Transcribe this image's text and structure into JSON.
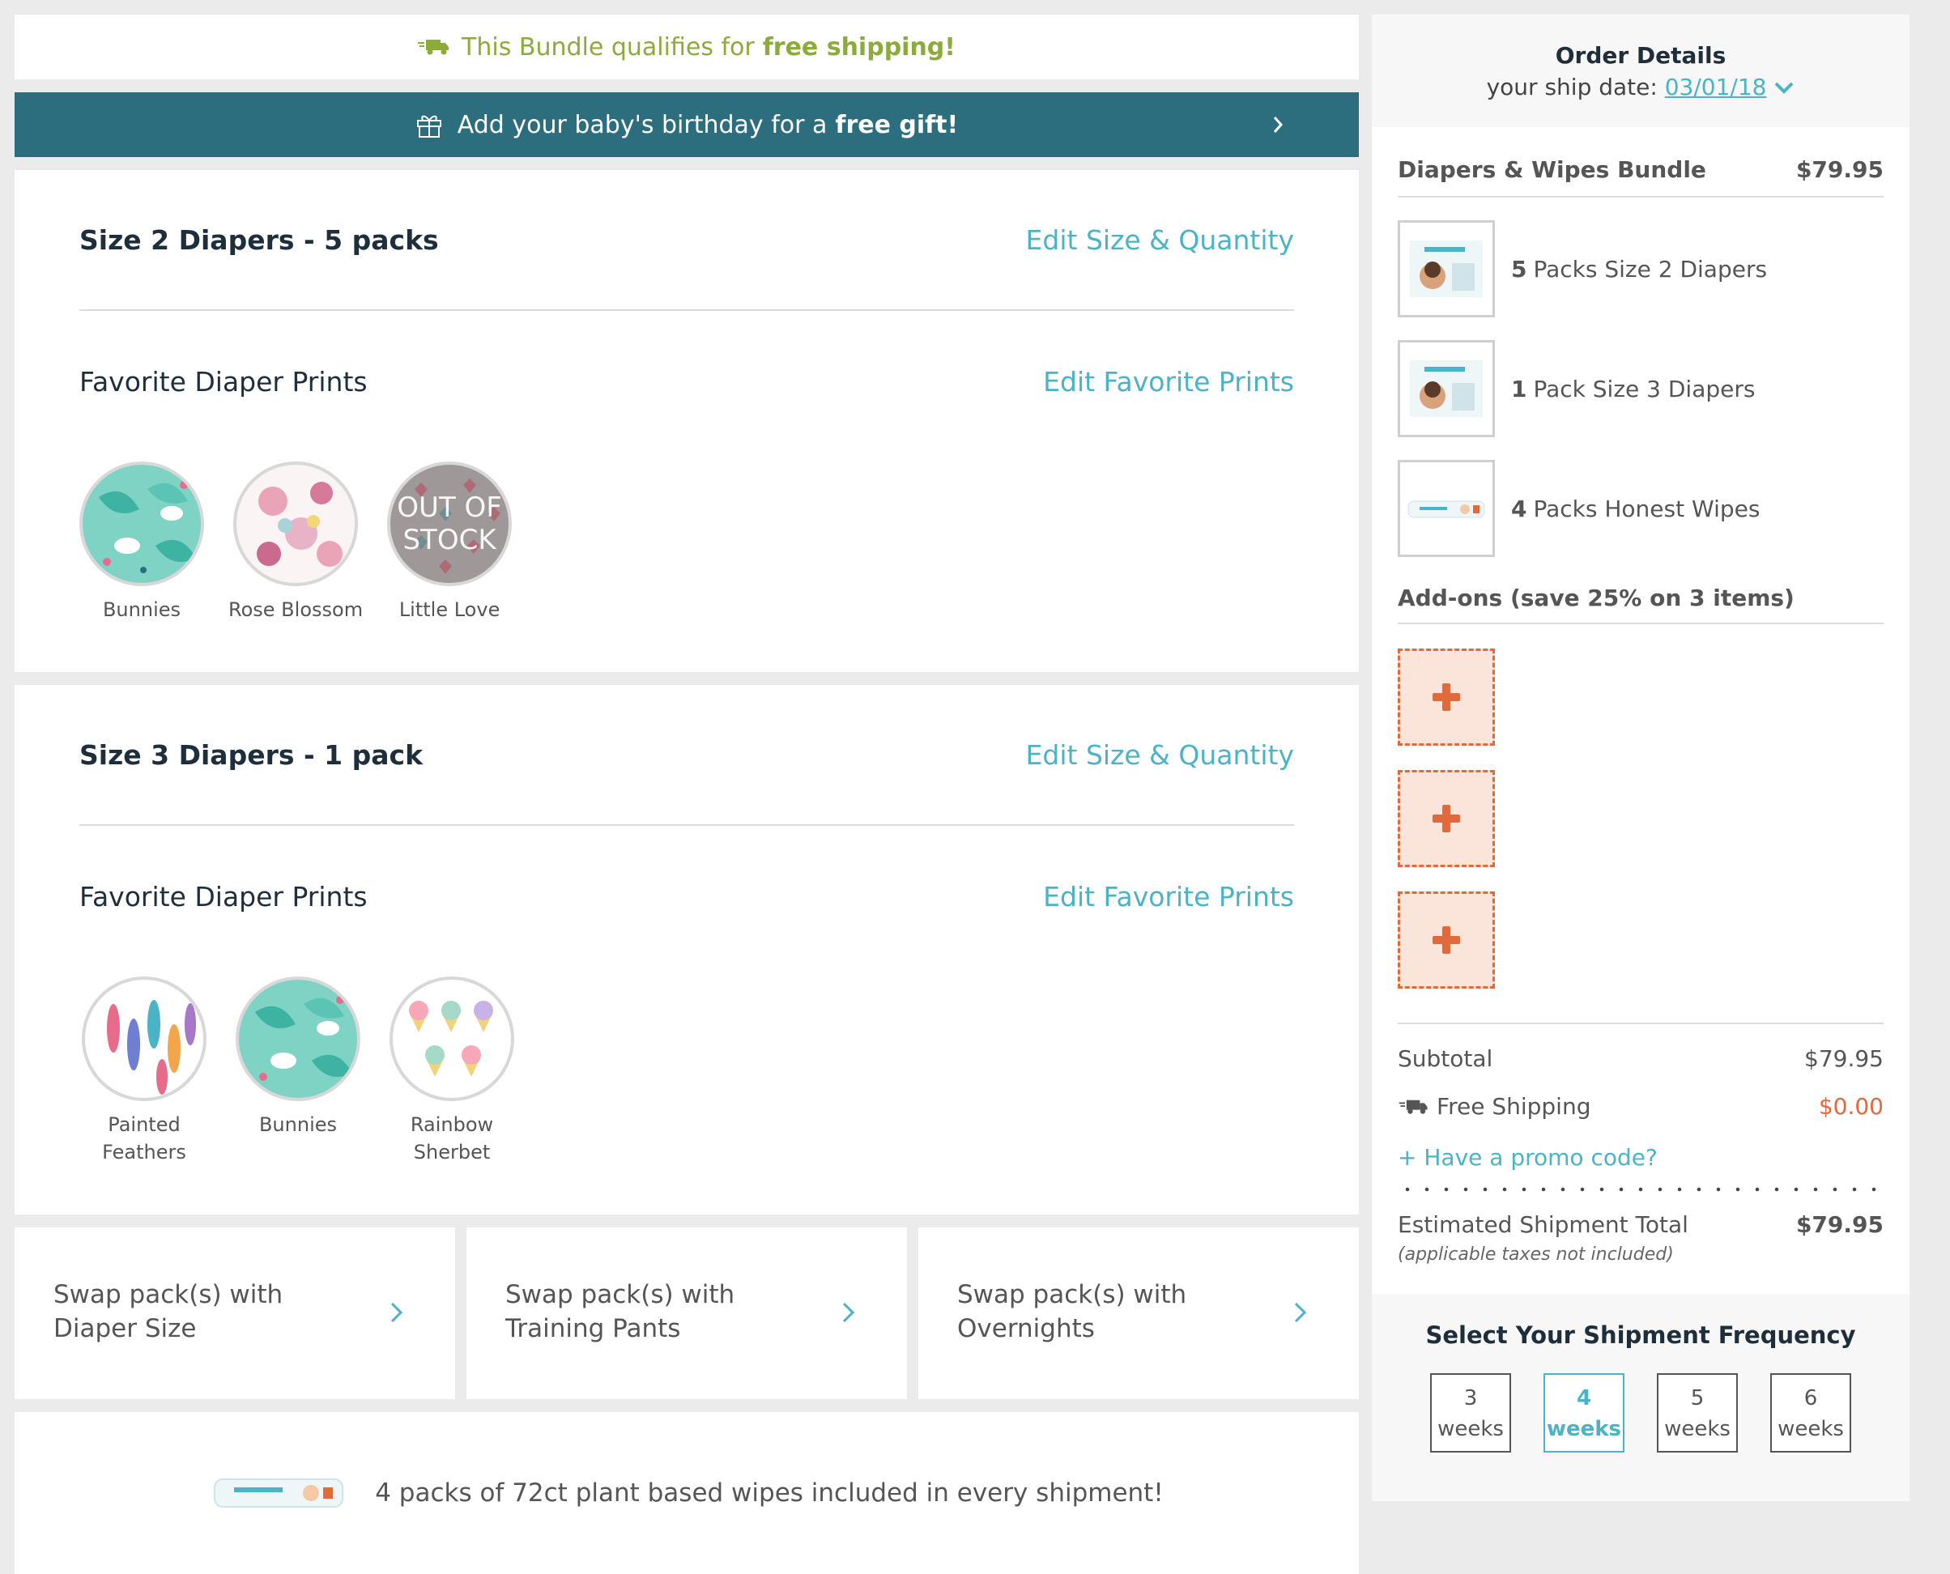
{
  "banners": {
    "shipping_text": "This Bundle qualifies for",
    "shipping_bold": "free shipping!",
    "birthday_text": "Add your baby's birthday for a",
    "birthday_bold": "free gift!"
  },
  "sections": [
    {
      "title": "Size 2 Diapers - 5 packs",
      "edit_size_label": "Edit Size & Quantity",
      "prints_title": "Favorite Diaper Prints",
      "edit_prints_label": "Edit Favorite Prints",
      "prints": [
        "Bunnies",
        "Rose Blossom",
        "Little Love"
      ],
      "out_of_stock_label": "OUT OF STOCK"
    },
    {
      "title": "Size 3 Diapers - 1 pack",
      "edit_size_label": "Edit Size & Quantity",
      "prints_title": "Favorite Diaper Prints",
      "edit_prints_label": "Edit Favorite Prints",
      "prints": [
        "Painted Feathers",
        "Bunnies",
        "Rainbow Sherbet"
      ]
    }
  ],
  "swaps": [
    {
      "line1": "Swap pack(s) with",
      "line2": "Diaper Size"
    },
    {
      "line1": "Swap pack(s) with",
      "line2": "Training Pants"
    },
    {
      "line1": "Swap pack(s) with",
      "line2": "Overnights"
    }
  ],
  "wipes_note": "4 packs of 72ct plant based wipes included in every shipment!",
  "order": {
    "title": "Order Details",
    "ship_date_label": "your ship date:",
    "ship_date": "03/01/18",
    "bundle_name": "Diapers & Wipes Bundle",
    "bundle_price": "$79.95",
    "items": [
      {
        "qty": "5",
        "label": "Packs Size 2 Diapers"
      },
      {
        "qty": "1",
        "label": "Pack Size 3 Diapers"
      },
      {
        "qty": "4",
        "label": "Packs Honest Wipes"
      }
    ],
    "addons_title": "Add-ons (save 25% on 3 items)",
    "subtotal_label": "Subtotal",
    "subtotal": "$79.95",
    "shipping_label": "Free Shipping",
    "shipping": "$0.00",
    "promo_label": "+ Have a promo code?",
    "total_label": "Estimated Shipment Total",
    "total": "$79.95",
    "tax_note": "(applicable taxes not included)"
  },
  "frequency": {
    "title": "Select Your Shipment Frequency",
    "options": [
      {
        "num": "3",
        "unit": "weeks"
      },
      {
        "num": "4",
        "unit": "weeks"
      },
      {
        "num": "5",
        "unit": "weeks"
      },
      {
        "num": "6",
        "unit": "weeks"
      }
    ],
    "selected": "4"
  },
  "colors": {
    "accent": "#4bb3c6",
    "banner_teal": "#2d6e7e",
    "shipping_green": "#8cab3a",
    "addon_orange": "#e06a3b"
  }
}
